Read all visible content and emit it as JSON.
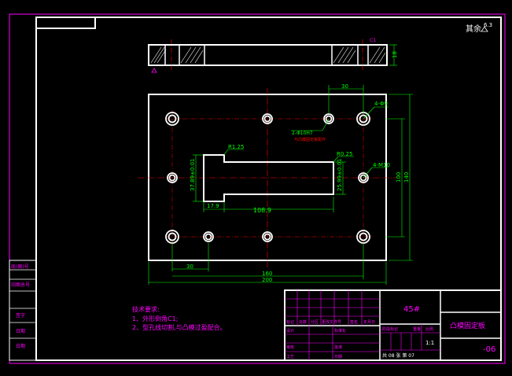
{
  "colors": {
    "background": "#000000",
    "outline": "#ffffff",
    "frame": "#ff00ff",
    "dimension": "#00ff00",
    "centerline": "#ff0000",
    "annotation": "#ff00ff",
    "accent_text": "#ff00ff"
  },
  "roughness": {
    "label": "其余",
    "value": "6.3"
  },
  "section_view": {
    "thickness": "18",
    "chamfer_mark": "C1"
  },
  "plan_view": {
    "dims": {
      "pitch_top": "30",
      "hole_4_top": "4-Φ9",
      "pin_note": "2-Φ10H7",
      "pin_note2": "与凸模固定板配作",
      "hole_4_side": "4-M10",
      "r_left": "R1.25",
      "r_right": "R0.25",
      "slot_h_left": "37.89±0.01",
      "slot_h_right": "25.99±0.01",
      "slot_offset": "17.9",
      "slot_len": "108.9",
      "height_inner": "100",
      "height_outer": "140",
      "pitch_bottom": "30",
      "width_inner": "160",
      "width_outer": "200"
    }
  },
  "tech_notes": {
    "title": "技术要求:",
    "items": [
      "1、外形倒角C1;",
      "2、型孔线切割,与凸模过盈配合。"
    ]
  },
  "left_block": {
    "labels": [
      "底(图)号",
      "旧图总号",
      "签字",
      "日期",
      "日期"
    ]
  },
  "title_block": {
    "material": "45#",
    "part_name": "凸模固定板",
    "drawing_no": "-06",
    "scale": "1:1",
    "sheet_text": "共 08 张  第 07",
    "row_labels": [
      "标记",
      "处数",
      "分区",
      "更改文件号",
      "签名",
      "年月日"
    ],
    "design_labels": [
      "设计",
      "标准化",
      "审核",
      "工艺",
      "批准",
      "日期"
    ],
    "stage_labels": [
      "阶段标记",
      "重量",
      "比例"
    ]
  }
}
